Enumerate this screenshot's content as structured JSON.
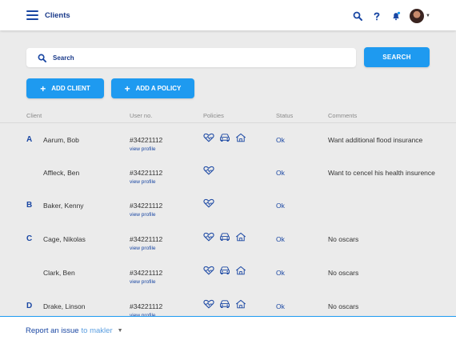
{
  "header": {
    "title": "Clients",
    "icons": [
      "menu-icon",
      "search-icon",
      "help-icon",
      "notification-bell-icon",
      "user-avatar"
    ]
  },
  "search": {
    "placeholder": "Search",
    "button_label": "SEARCH"
  },
  "actions": {
    "add_client": "ADD CLIENT",
    "add_policy": "ADD A POLICY"
  },
  "columns": {
    "client": "Client",
    "user_no": "User no.",
    "policies": "Policies",
    "status": "Status",
    "comments": "Comments"
  },
  "rows": [
    {
      "letter": "A",
      "name": "Aarum, Bob",
      "user_no": "#34221112",
      "link": "view profile",
      "policies": [
        "health",
        "car",
        "home"
      ],
      "status": "Ok",
      "comment": "Want additional flood insurance"
    },
    {
      "letter": "",
      "name": "Affleck, Ben",
      "user_no": "#34221112",
      "link": "view profile",
      "policies": [
        "health"
      ],
      "status": "Ok",
      "comment": "Want to cencel his health insurence"
    },
    {
      "letter": "B",
      "name": "Baker, Kenny",
      "user_no": "#34221112",
      "link": "view profile",
      "policies": [
        "health"
      ],
      "status": "Ok",
      "comment": ""
    },
    {
      "letter": "C",
      "name": "Cage, Nikolas",
      "user_no": "#34221112",
      "link": "view profile",
      "policies": [
        "health",
        "car",
        "home"
      ],
      "status": "Ok",
      "comment": "No oscars"
    },
    {
      "letter": "",
      "name": "Clark, Ben",
      "user_no": "#34221112",
      "link": "view profile",
      "policies": [
        "health",
        "car",
        "home"
      ],
      "status": "Ok",
      "comment": "No oscars"
    },
    {
      "letter": "D",
      "name": "Drake, Linson",
      "user_no": "#34221112",
      "link": "view profile",
      "policies": [
        "health",
        "car",
        "home"
      ],
      "status": "Ok",
      "comment": "No oscars"
    }
  ],
  "footer": {
    "report_prefix": "Report an issue",
    "report_suffix": "to makler"
  },
  "colors": {
    "accent": "#1e9af0",
    "brand": "#1a47a3",
    "background": "#ebebeb"
  }
}
